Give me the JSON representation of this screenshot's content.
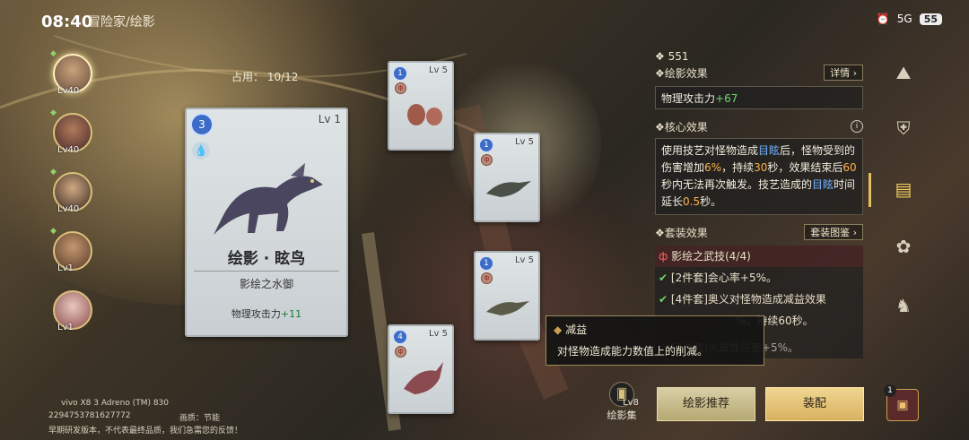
{
  "status": {
    "time": "08:40",
    "network": "5G",
    "battery": "55"
  },
  "breadcrumb": "冒险家/绘影",
  "portraits": [
    {
      "level": "Lv40",
      "selected": true
    },
    {
      "level": "Lv40",
      "selected": false
    },
    {
      "level": "Lv40",
      "selected": false
    },
    {
      "level": "Lv1",
      "selected": false
    },
    {
      "level": "Lv1",
      "selected": false
    }
  ],
  "occupancy": "占用：  10/12",
  "main_card": {
    "rarity": "3",
    "level": "Lv 1",
    "element_icon": "water-drop-icon",
    "name": "绘影 · 眩鸟",
    "set_name": "影绘之水御",
    "stat_label": "物理攻击力",
    "stat_value": "+11"
  },
  "slot_cards": [
    {
      "rarity": "1",
      "level": "Lv 5"
    },
    {
      "rarity": "1",
      "level": "Lv 5"
    },
    {
      "rarity": "1",
      "level": "Lv 5"
    },
    {
      "rarity": "4",
      "level": "Lv 5"
    }
  ],
  "right_panel": {
    "score": "551",
    "shadow_effect_title": "绘影效果",
    "details_button": "详情",
    "shadow_effect_label": "物理攻击力",
    "shadow_effect_value": "+67",
    "core_effect_title": "核心效果",
    "core_text": {
      "p1": "使用技艺对怪物造成",
      "k1": "目眩",
      "p2": "后，怪物受到的伤害增加",
      "k2": "6%",
      "p3": "，持续",
      "k3": "30",
      "p4": "秒，效果结束后",
      "k4": "60",
      "p5": "秒内无法再次触发。技艺造成的",
      "k5": "目眩",
      "p6": "时间延长",
      "k6": "0.5",
      "p7": "秒。"
    },
    "set_effect_title": "套装效果",
    "set_catalog_button": "套装图鉴",
    "set_rows": [
      {
        "text": "影绘之武技(4/4)"
      },
      {
        "text": "[2件套]会心率+5%。"
      },
      {
        "text": "[4件套]奥义对怪物造成减益效果"
      },
      {
        "text": "%，持续60秒。"
      },
      {
        "text": "[2件套]水属性伤害+5%。"
      }
    ]
  },
  "tooltip": {
    "title": "减益",
    "body": "对怪物造成能力数值上的削减。"
  },
  "gallery": {
    "level": "Lv8",
    "label": "绘影集"
  },
  "buttons": {
    "recommend": "绘影推荐",
    "equip": "装配"
  },
  "chest_count": "1",
  "watermark": {
    "line1": "vivo  X8  3  Adreno (TM) 830",
    "line2": "2294753781627772",
    "line3": "画质：节能",
    "line4": "早期研发版本，不代表最终品质，我们急需您的反馈！"
  },
  "nav_icons": [
    "mountain-icon",
    "armor-icon",
    "card-icon",
    "pawprint-icon",
    "figure-icon"
  ]
}
